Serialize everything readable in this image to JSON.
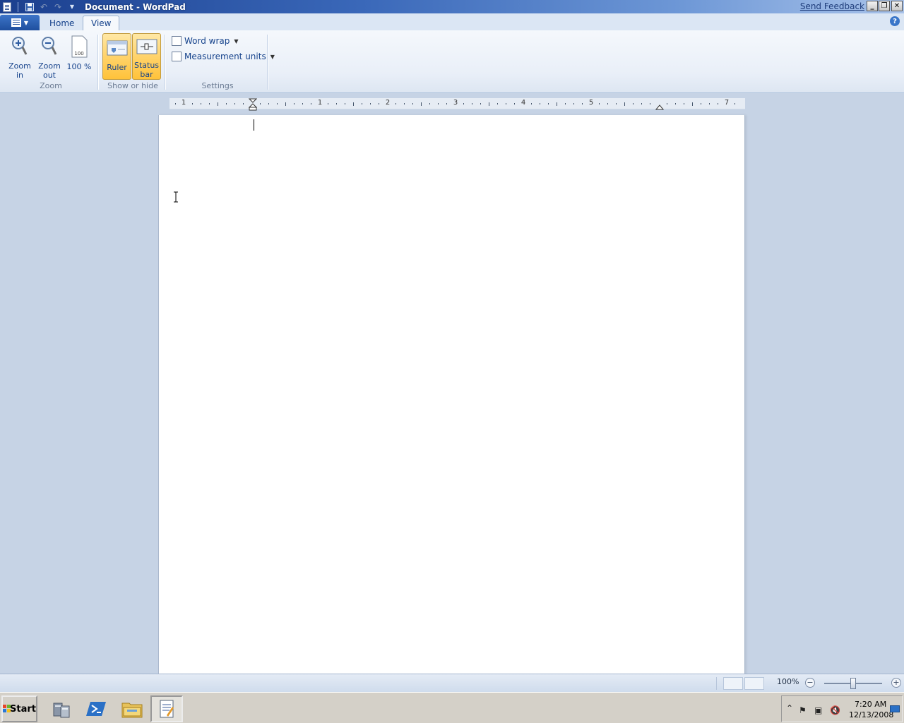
{
  "window": {
    "title": "Document - WordPad",
    "send_feedback": "Send Feedback"
  },
  "tabs": [
    {
      "label": "Home",
      "active": false
    },
    {
      "label": "View",
      "active": true
    }
  ],
  "ribbon": {
    "zoom_group": {
      "label": "Zoom",
      "zoom_in": "Zoom in",
      "zoom_out": "Zoom out",
      "hundred": "100 %",
      "hundred_icon_text": "100"
    },
    "show_hide_group": {
      "label": "Show or hide",
      "ruler": "Ruler",
      "status_bar": "Status bar",
      "ruler_checked": true,
      "status_bar_checked": true
    },
    "settings_group": {
      "label": "Settings",
      "word_wrap": "Word wrap",
      "measurement_units": "Measurement units"
    }
  },
  "ruler": {
    "numbers": [
      "1",
      "1",
      "2",
      "3",
      "4",
      "5",
      "7"
    ]
  },
  "statusbar": {
    "zoom_percent": "100%",
    "zoom_level": 1.0
  },
  "taskbar": {
    "start_label": "Start",
    "time": "7:20 AM",
    "date": "12/13/2008",
    "items": [
      "server-manager",
      "powershell",
      "explorer",
      "wordpad"
    ],
    "active_item": "wordpad"
  },
  "colors": {
    "ribbon_pressed": "#ffd36b",
    "titlebar_dark": "#1b3f8e",
    "workspace": "#c6d3e5"
  }
}
